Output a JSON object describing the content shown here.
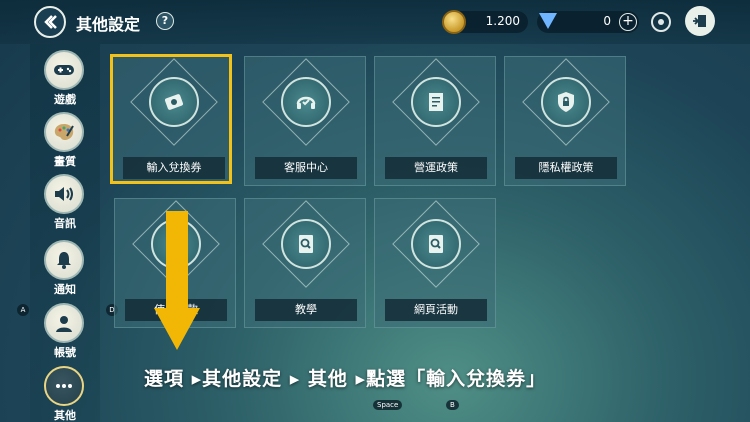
{
  "header": {
    "title": "其他設定",
    "help_label": "?",
    "gold_amount": "1.200",
    "gem_amount": "0",
    "plus_label": "+"
  },
  "sidebar": {
    "items": [
      {
        "label": "遊戲",
        "icon": "gamepad-icon"
      },
      {
        "label": "畫質",
        "icon": "palette-icon"
      },
      {
        "label": "音訊",
        "icon": "speaker-icon"
      },
      {
        "label": "通知",
        "icon": "bell-icon"
      },
      {
        "label": "帳號",
        "icon": "account-icon"
      },
      {
        "label": "其他",
        "icon": "more-icon"
      }
    ],
    "key_a": "A",
    "key_d": "D"
  },
  "cards": [
    {
      "label": "輸入兌換券",
      "icon": "coupon-icon"
    },
    {
      "label": "客服中心",
      "icon": "headset-icon"
    },
    {
      "label": "營運政策",
      "icon": "document-icon"
    },
    {
      "label": "隱私權政策",
      "icon": "lock-icon"
    },
    {
      "label": "使用條款",
      "icon": "shield-icon"
    },
    {
      "label": "教學",
      "icon": "book-search-icon"
    },
    {
      "label": "網頁活動",
      "icon": "book-search-icon"
    }
  ],
  "instruction": "選項 ▸其他設定 ▸ 其他 ▸點選「輸入兌換券」",
  "bottom_keys": {
    "space": "Space",
    "b": "B"
  },
  "colors": {
    "highlight": "#f2c21b",
    "arrow": "#f2b705"
  }
}
